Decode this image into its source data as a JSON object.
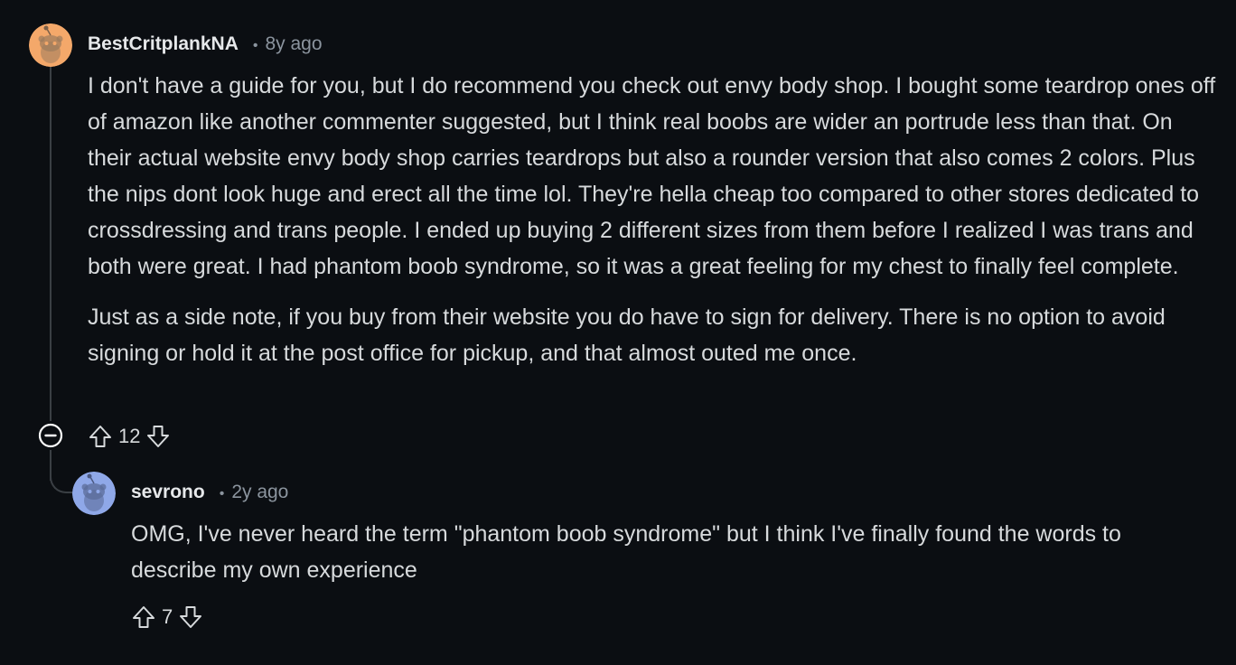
{
  "comments": [
    {
      "username": "BestCritplankNA",
      "separator": "•",
      "time": "8y ago",
      "paragraphs": [
        "I don't have a guide for you, but I do recommend you check out envy body shop. I bought some teardrop ones off of amazon like another commenter suggested, but I think real boobs are wider an portrude less than that. On their actual website envy body shop carries teardrops but also a rounder version that also comes 2 colors. Plus the nips dont look huge and erect all the time lol. They're hella cheap too compared to other stores dedicated to crossdressing and trans people. I ended up buying 2 different sizes from them before I realized I was trans and both were great. I had phantom boob syndrome, so it was a great feeling for my chest to finally feel complete.",
        "Just as a side note, if you buy from their website you do have to sign for delivery. There is no option to avoid signing or hold it at the post office for pickup, and that almost outed me once."
      ],
      "score": "12",
      "avatar_color": "#f4a86a"
    },
    {
      "username": "sevrono",
      "separator": "•",
      "time": "2y ago",
      "paragraphs": [
        "OMG, I've never heard the term \"phantom boob syndrome\" but I think I've finally found the words to describe my own experience"
      ],
      "score": "7",
      "avatar_color": "#8fa8e8"
    }
  ],
  "icons": {
    "upvote": "upvote-icon",
    "downvote": "downvote-icon",
    "collapse": "collapse-thread-icon",
    "avatar": "snoo-avatar-icon"
  },
  "colors": {
    "background": "#0b0e12",
    "text": "#d7dadc",
    "meta": "#8b949e",
    "thread_line": "#3a3f44"
  }
}
